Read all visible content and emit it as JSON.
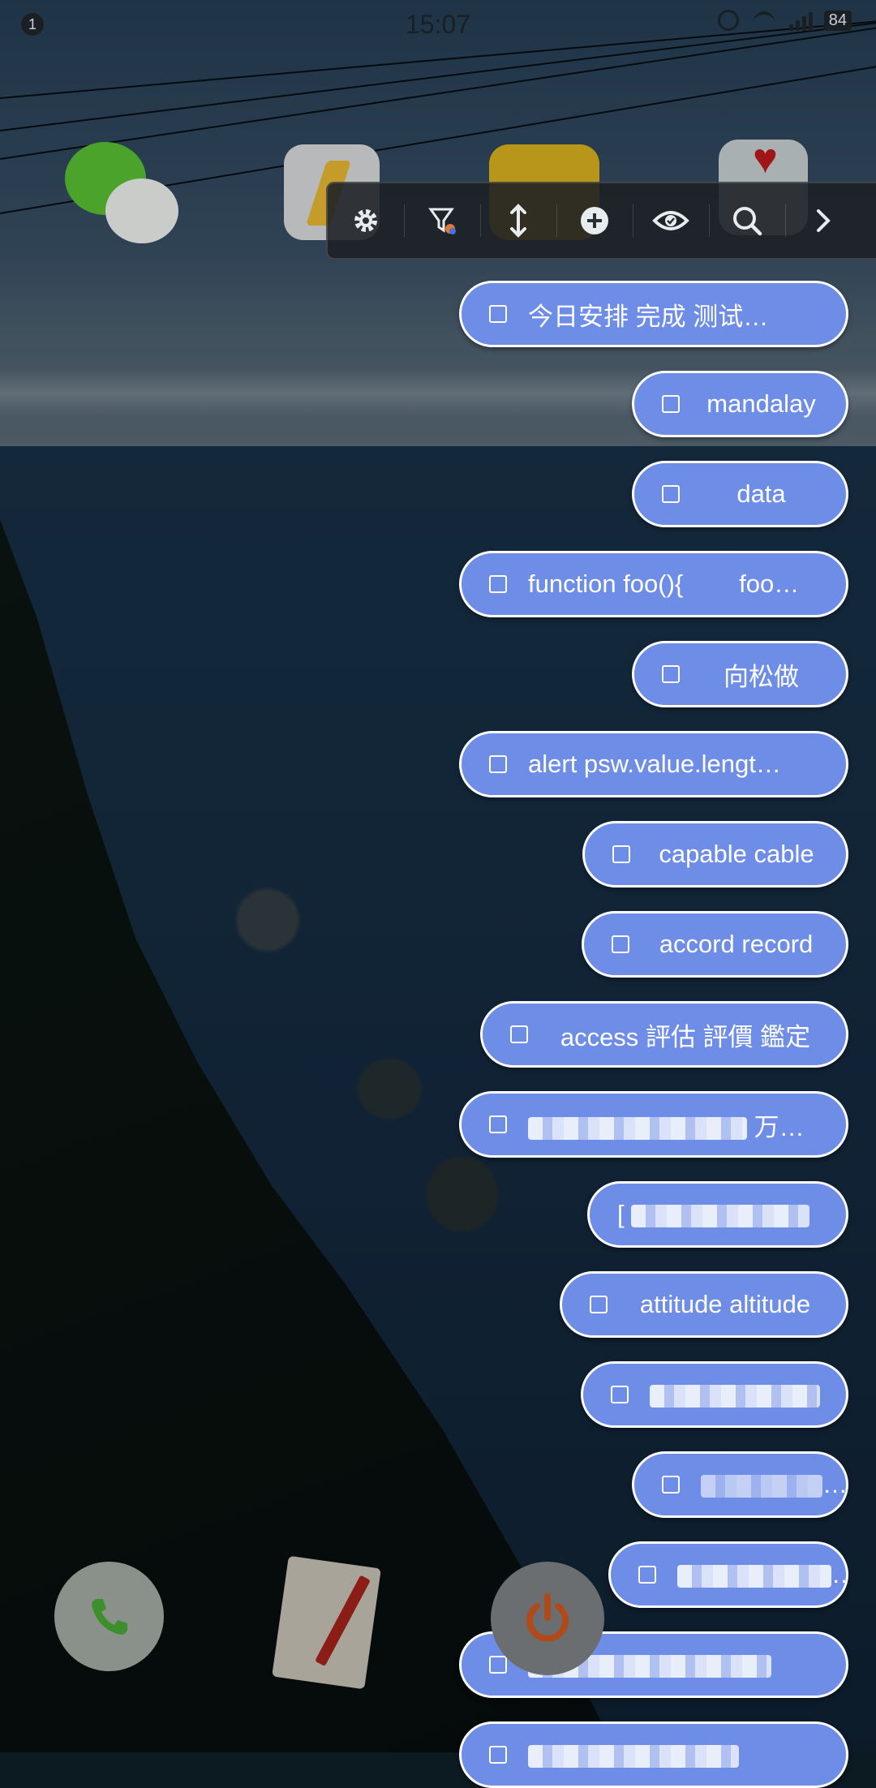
{
  "status_bar": {
    "notification_count": "1",
    "time": "15:07",
    "battery": "84",
    "icons": [
      "alarm-icon",
      "wifi-icon",
      "signal-icon",
      "battery-icon"
    ]
  },
  "home_apps": [
    "wechat",
    "lightning-app",
    "mail-app",
    "health-app"
  ],
  "dock_apps": [
    "phone",
    "notes",
    "power"
  ],
  "toolbar": {
    "buttons": [
      "settings-icon",
      "filter-icon",
      "expand-vertical-icon",
      "add-icon",
      "eye-icon",
      "search-icon",
      "chevron-right-icon"
    ]
  },
  "clips": [
    {
      "text": "今日安排 完成 测试…"
    },
    {
      "text": "mandalay"
    },
    {
      "text": "data"
    },
    {
      "text": "function foo(){        foo…"
    },
    {
      "text": "向松做"
    },
    {
      "text": "alert psw.value.lengt…"
    },
    {
      "text": "capable cable"
    },
    {
      "text": "accord record"
    },
    {
      "text": "access 評估 評價 鑑定"
    },
    {
      "text": "万…",
      "redacted": true
    },
    {
      "text": "[",
      "redacted": true
    },
    {
      "text": "attitude altitude"
    },
    {
      "text": "",
      "redacted": true
    },
    {
      "text": "",
      "redacted": true
    },
    {
      "text": "",
      "redacted": true
    },
    {
      "text": "",
      "redacted": true
    },
    {
      "text": "",
      "redacted": true
    }
  ]
}
